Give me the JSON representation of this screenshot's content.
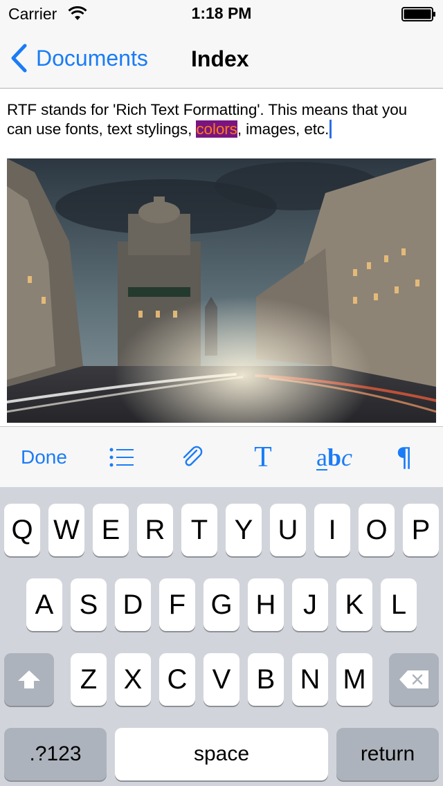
{
  "status_bar": {
    "carrier": "Carrier",
    "time": "1:18 PM"
  },
  "nav": {
    "back_label": "Documents",
    "title": "Index"
  },
  "editor": {
    "text_before": "RTF stands for 'Rich Text Formatting'. This means that you can use fonts, text stylings, ",
    "highlighted_word": "colors",
    "text_after": ", images, etc.",
    "highlight_colors": {
      "background": "#7a1580",
      "text": "#ff7a1a"
    },
    "image_description_icon": "street-photo"
  },
  "toolbar": {
    "done_label": "Done",
    "font_label": "T",
    "abc_a": "a",
    "abc_b": "b",
    "abc_c": "c",
    "paragraph_label": "¶",
    "icons": [
      "list-icon",
      "paperclip-icon",
      "font-icon",
      "text-style-icon",
      "paragraph-icon"
    ]
  },
  "keyboard": {
    "row1": [
      "Q",
      "W",
      "E",
      "R",
      "T",
      "Y",
      "U",
      "I",
      "O",
      "P"
    ],
    "row2": [
      "A",
      "S",
      "D",
      "F",
      "G",
      "H",
      "J",
      "K",
      "L"
    ],
    "row3": [
      "Z",
      "X",
      "C",
      "V",
      "B",
      "N",
      "M"
    ],
    "numbers_label": ".?123",
    "space_label": "space",
    "return_label": "return"
  },
  "colors": {
    "accent": "#1a7cf6",
    "keyboard_bg": "#d1d5db"
  }
}
